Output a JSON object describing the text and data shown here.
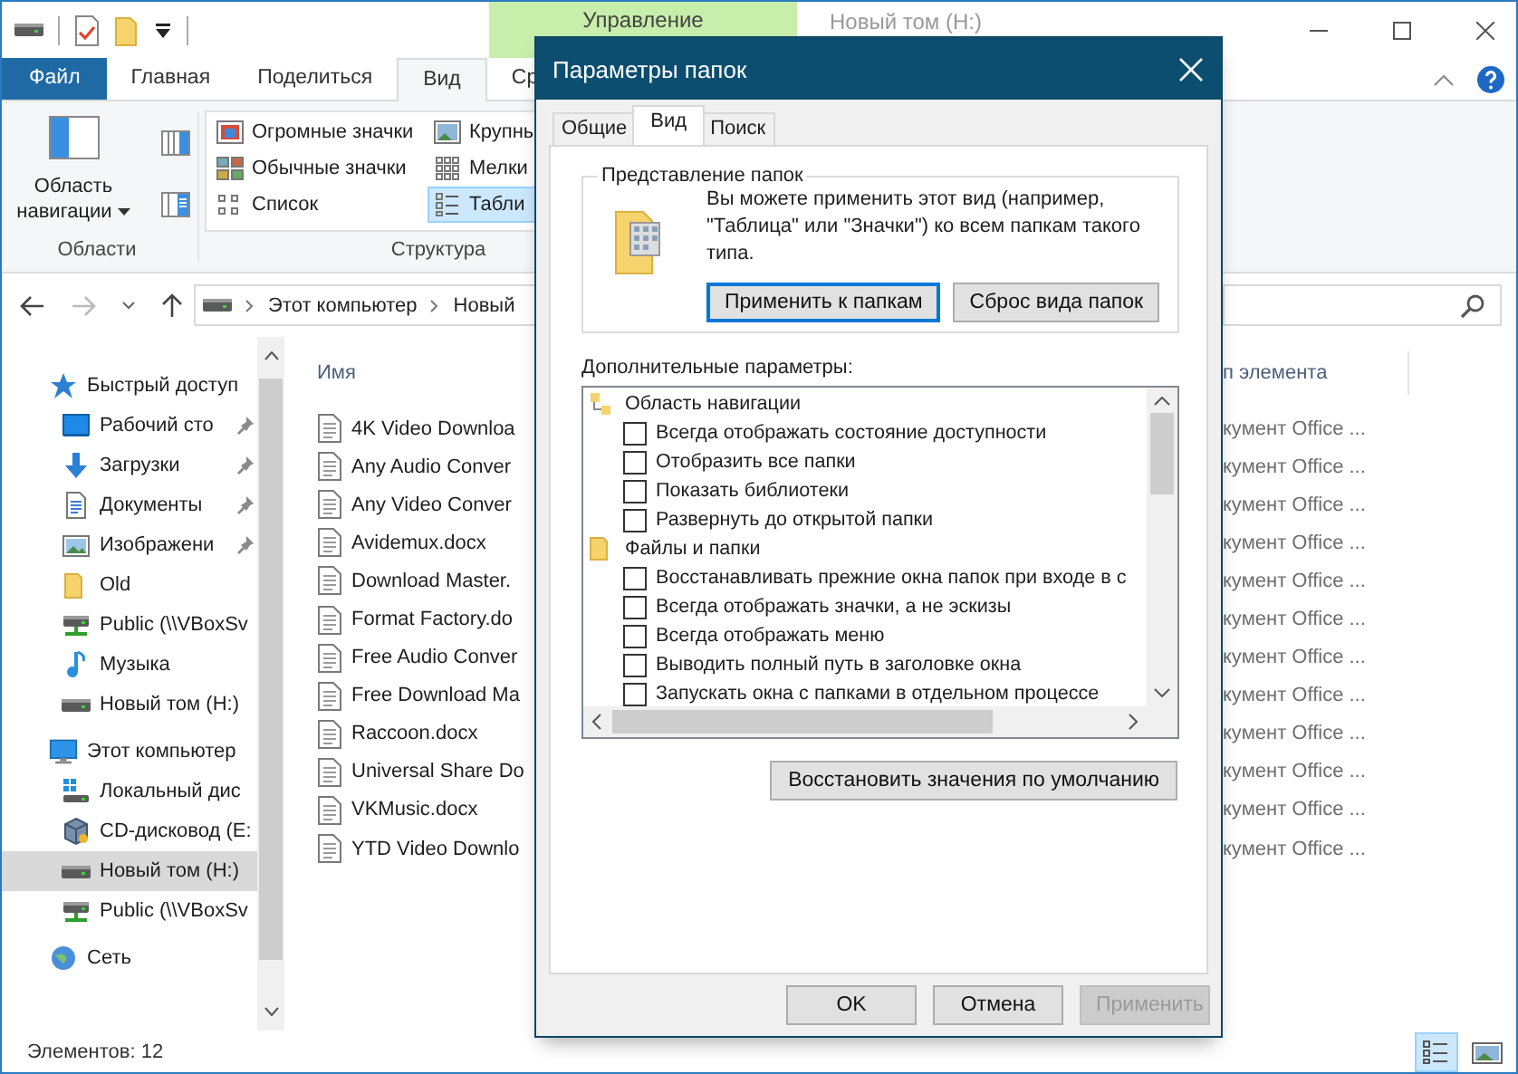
{
  "title_bar": {
    "context_tab": "Управление",
    "title": "Новый том (H:)"
  },
  "ribbon": {
    "tabs": [
      {
        "label": "Файл",
        "kind": "file",
        "selected": false
      },
      {
        "label": "Главная",
        "kind": "tab",
        "selected": false
      },
      {
        "label": "Поделиться",
        "kind": "tab",
        "selected": false
      },
      {
        "label": "Вид",
        "kind": "tab",
        "selected": true
      },
      {
        "label": "Ср",
        "kind": "tab",
        "selected": false
      }
    ],
    "panes_group": {
      "button": "Область навигации",
      "label": "Области"
    },
    "layout_group": {
      "label": "Структура",
      "layouts": [
        {
          "label": "Огромные значки",
          "selected": false
        },
        {
          "label": "Обычные значки",
          "selected": false
        },
        {
          "label": "Список",
          "selected": false
        },
        {
          "label": "Крупны",
          "selected": false
        },
        {
          "label": "Мелки",
          "selected": false
        },
        {
          "label": "Табли",
          "selected": true
        }
      ]
    }
  },
  "address": {
    "path": [
      "Этот компьютер",
      "Новый"
    ]
  },
  "navigation": [
    {
      "label": "Быстрый доступ",
      "selected": false,
      "children": [
        {
          "label": "Рабочий сто",
          "pinned": true,
          "selected": false
        },
        {
          "label": "Загрузки",
          "pinned": true,
          "selected": false
        },
        {
          "label": "Документы",
          "pinned": true,
          "selected": false
        },
        {
          "label": "Изображени",
          "pinned": true,
          "selected": false
        },
        {
          "label": "Old",
          "pinned": false,
          "selected": false
        },
        {
          "label": "Public (\\\\VBoxSv",
          "pinned": false,
          "selected": false
        },
        {
          "label": "Музыка",
          "pinned": false,
          "selected": false
        },
        {
          "label": "Новый том (H:)",
          "pinned": false,
          "selected": false
        }
      ]
    },
    {
      "label": "Этот компьютер",
      "selected": false,
      "children": [
        {
          "label": "Локальный дис",
          "selected": false
        },
        {
          "label": "CD-дисковод (E:",
          "selected": false
        },
        {
          "label": "Новый том (H:)",
          "selected": true
        },
        {
          "label": "Public (\\\\VBoxSv",
          "selected": false
        }
      ]
    },
    {
      "label": "Сеть",
      "selected": false
    }
  ],
  "files": {
    "columns": [
      "Имя",
      "п элемента"
    ],
    "rows": [
      {
        "name": "4K Video Downloa",
        "type": "кумент Office ..."
      },
      {
        "name": "Any Audio Conver",
        "type": "кумент Office ..."
      },
      {
        "name": "Any Video Conver",
        "type": "кумент Office ..."
      },
      {
        "name": "Avidemux.docx",
        "type": "кумент Office ..."
      },
      {
        "name": "Download Master.",
        "type": "кумент Office ..."
      },
      {
        "name": "Format Factory.do",
        "type": "кумент Office ..."
      },
      {
        "name": "Free Audio Conver",
        "type": "кумент Office ..."
      },
      {
        "name": "Free Download Ma",
        "type": "кумент Office ..."
      },
      {
        "name": "Raccoon.docx",
        "type": "кумент Office ..."
      },
      {
        "name": "Universal Share Do",
        "type": "кумент Office ..."
      },
      {
        "name": "VKMusic.docx",
        "type": "кумент Office ..."
      },
      {
        "name": "YTD Video Downlo",
        "type": "кумент Office ..."
      }
    ]
  },
  "status_bar": {
    "count": "Элементов: 12",
    "views": [
      {
        "selected": true
      },
      {
        "selected": false
      }
    ]
  },
  "dialog": {
    "title": "Параметры папок",
    "tabs": [
      {
        "label": "Общие",
        "selected": false
      },
      {
        "label": "Вид",
        "selected": true
      },
      {
        "label": "Поиск",
        "selected": false
      }
    ],
    "folder_views": {
      "title": "Представление папок",
      "text": "Вы можете применить этот вид (например, \"Таблица\" или \"Значки\") ко всем папкам такого типа.",
      "buttons": [
        {
          "label": "Применить к папкам",
          "focused": true
        },
        {
          "label": "Сброс вида папок",
          "focused": false
        }
      ]
    },
    "advanced": {
      "label": "Дополнительные параметры:",
      "items": [
        {
          "kind": "category",
          "label": "Область навигации",
          "children": [
            {
              "kind": "checkbox",
              "label": "Всегда отображать состояние доступности",
              "checked": false
            },
            {
              "kind": "checkbox",
              "label": "Отобразить все папки",
              "checked": false
            },
            {
              "kind": "checkbox",
              "label": "Показать библиотеки",
              "checked": false
            },
            {
              "kind": "checkbox",
              "label": "Развернуть до открытой папки",
              "checked": false
            }
          ]
        },
        {
          "kind": "category",
          "label": "Файлы и папки",
          "children": [
            {
              "kind": "checkbox",
              "label": "Восстанавливать прежние окна папок при входе в с",
              "checked": false
            },
            {
              "kind": "checkbox",
              "label": "Всегда отображать значки, а не эскизы",
              "checked": false
            },
            {
              "kind": "checkbox",
              "label": "Всегда отображать меню",
              "checked": false
            },
            {
              "kind": "checkbox",
              "label": "Выводить полный путь в заголовке окна",
              "checked": false
            },
            {
              "kind": "checkbox",
              "label": "Запускать окна с папками в отдельном процессе",
              "checked": false
            }
          ]
        }
      ]
    },
    "restore_button": "Восстановить значения по умолчанию",
    "buttons": [
      {
        "label": "OK",
        "disabled": false
      },
      {
        "label": "Отмена",
        "disabled": false
      },
      {
        "label": "Применить",
        "disabled": true
      }
    ]
  }
}
